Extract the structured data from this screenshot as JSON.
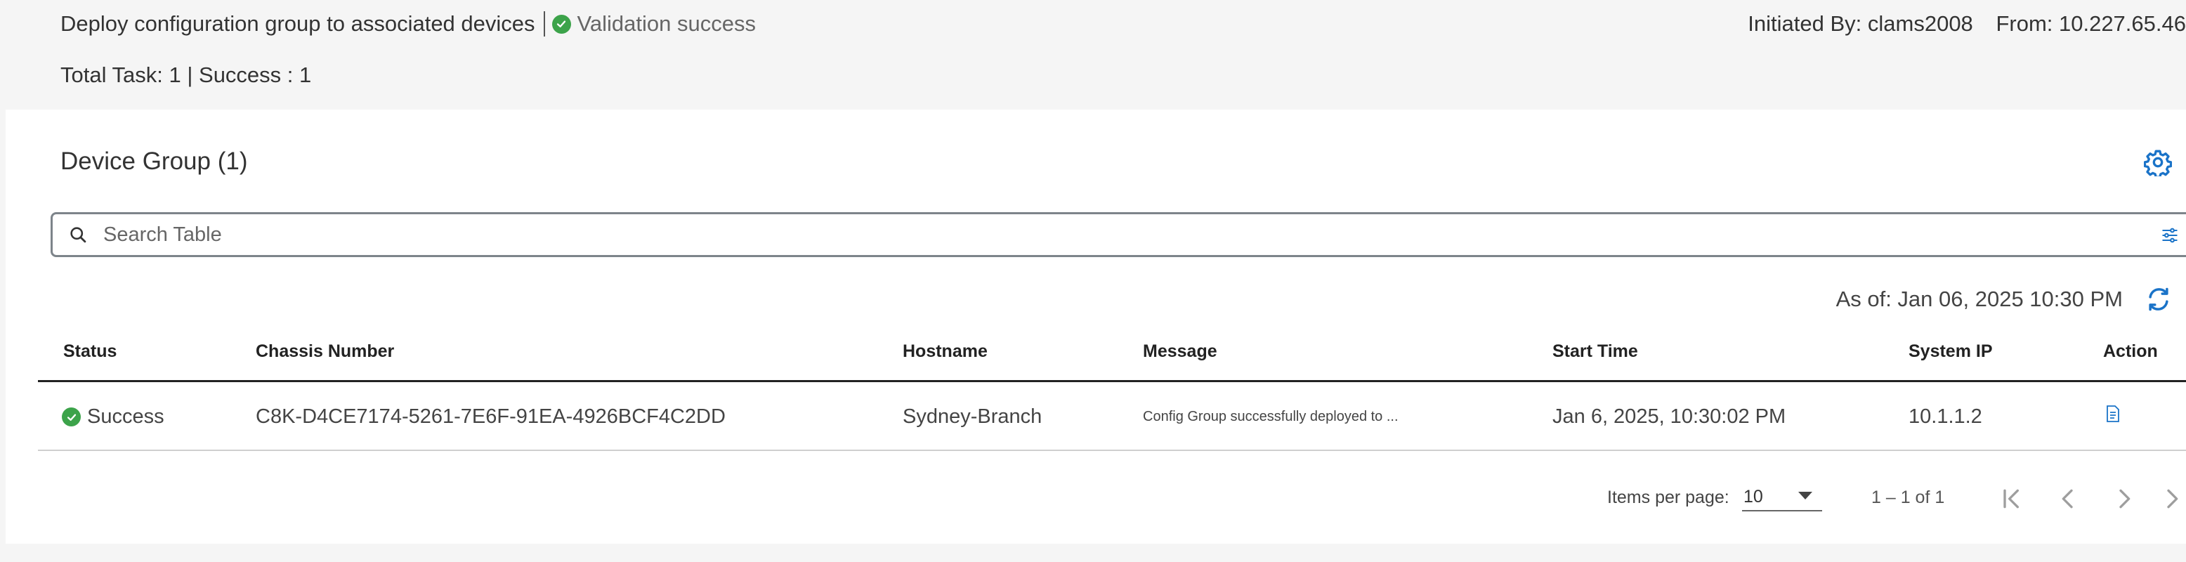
{
  "header": {
    "title": "Deploy configuration group to associated devices",
    "status": "Validation success",
    "initiated_by": "Initiated By: clams2008",
    "from": "From: 10.227.65.46",
    "tasks": "Total Task: 1 | Success : 1"
  },
  "group": {
    "title": "Device Group (1)",
    "settings_icon": "gear-icon"
  },
  "search": {
    "placeholder": "Search Table",
    "value": ""
  },
  "as_of": "As of: Jan 06, 2025 10:30 PM",
  "table": {
    "columns": [
      "Status",
      "Chassis Number",
      "Hostname",
      "Message",
      "Start Time",
      "System IP",
      "Action"
    ],
    "rows": [
      {
        "status": "Success",
        "chassis": "C8K-D4CE7174-5261-7E6F-91EA-4926BCF4C2DD",
        "hostname": "Sydney-Branch",
        "message": "Config Group successfully deployed to ...",
        "start_time": "Jan 6, 2025, 10:30:02 PM",
        "system_ip": "10.1.1.2",
        "action_icon": "document-icon"
      }
    ]
  },
  "pagination": {
    "items_per_page_label": "Items per page:",
    "items_per_page": "10",
    "range": "1 – 1 of 1"
  },
  "colors": {
    "success": "#3ca34a",
    "accent": "#1a73c8"
  }
}
